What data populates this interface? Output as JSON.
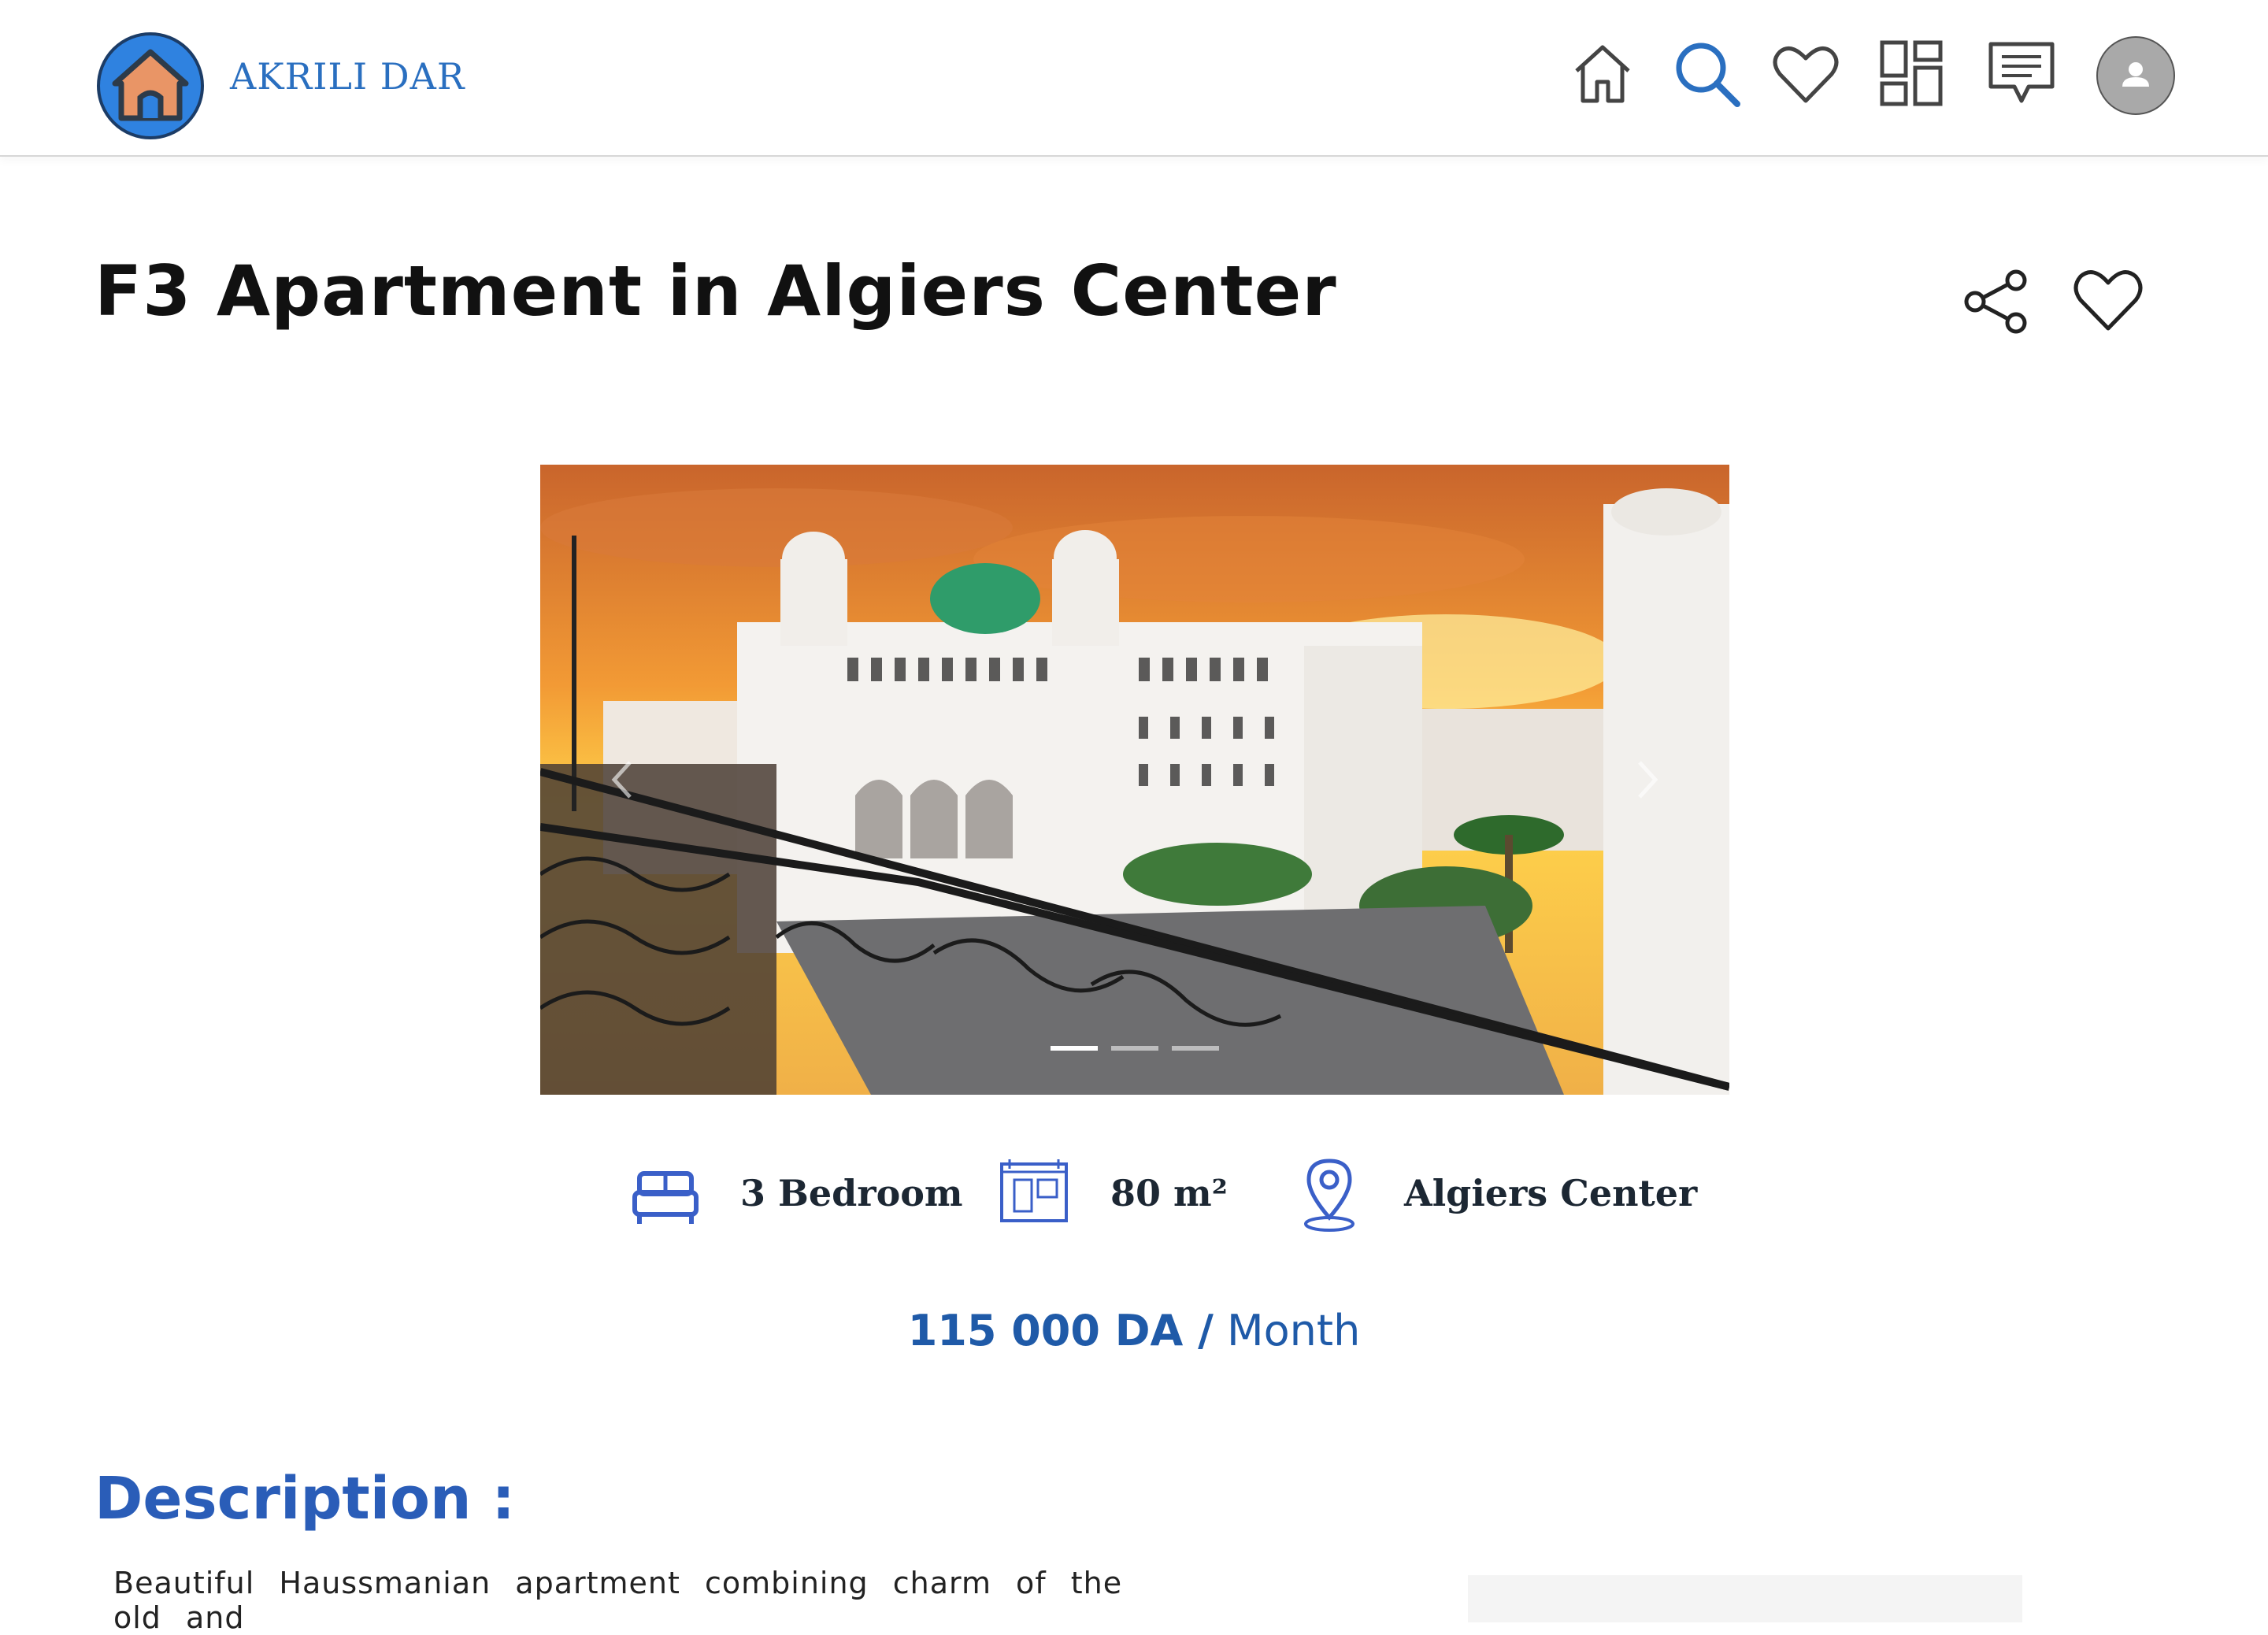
{
  "header": {
    "brand": "AKRILI DAR",
    "nav": [
      "home-icon",
      "search-icon",
      "heart-icon",
      "dashboard-icon",
      "messages-icon",
      "user-avatar"
    ],
    "active_nav": "search-icon",
    "accent_color": "#2a6fc0"
  },
  "listing": {
    "title": "F3 Apartment in Algiers Center",
    "gallery": {
      "slides": 3,
      "active_slide": 1
    },
    "features": {
      "bedrooms": "3 Bedroom",
      "area": "80 m²",
      "location": "Algiers Center"
    },
    "price": {
      "amount": "115 000 DA /",
      "period": "Month"
    },
    "description": {
      "heading": "Description :",
      "text": "Beautiful Haussmanian apartment combining charm of the old and"
    }
  },
  "colors": {
    "primary": "#2a5db8",
    "feature_icon": "#3a5fc8",
    "text_dark": "#1c2733"
  }
}
